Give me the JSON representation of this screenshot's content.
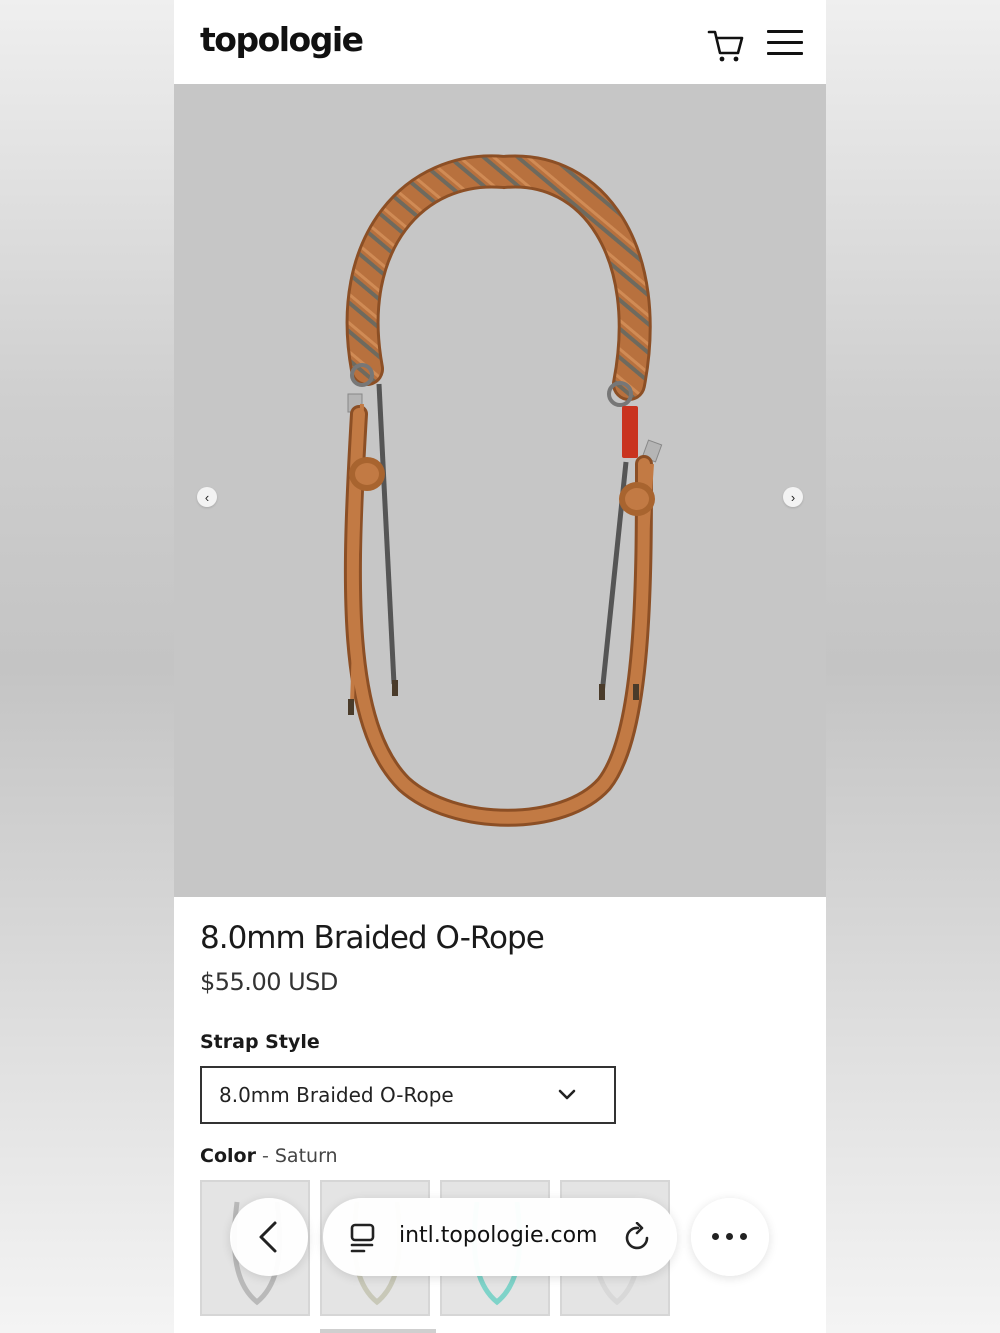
{
  "header": {
    "logo": "topologie",
    "icons": [
      "cart-icon",
      "menu-icon"
    ]
  },
  "gallery": {
    "prev_arrow": "‹",
    "next_arrow": "›",
    "image_subject": "braided orange rope strap with metal rings"
  },
  "product": {
    "title": "8.0mm Braided O-Rope",
    "price": "$55.00 USD"
  },
  "options": {
    "strap_style_label": "Strap Style",
    "strap_style_value": "8.0mm Braided O-Rope",
    "color_label": "Color",
    "color_separator": " - ",
    "color_value": "Saturn"
  },
  "swatch_colors": [
    "#b9b9b9",
    "#c8c8b8",
    "#7fd3c9",
    "#d8d8d8"
  ],
  "browser": {
    "url": "intl.topologie.com",
    "icons": [
      "back-icon",
      "tabs-icon",
      "reload-icon",
      "more-icon"
    ]
  },
  "colors": {
    "rope": "#b8713e",
    "rope_dark": "#8c4f25",
    "gallery_bg": "#c6c6c6"
  }
}
